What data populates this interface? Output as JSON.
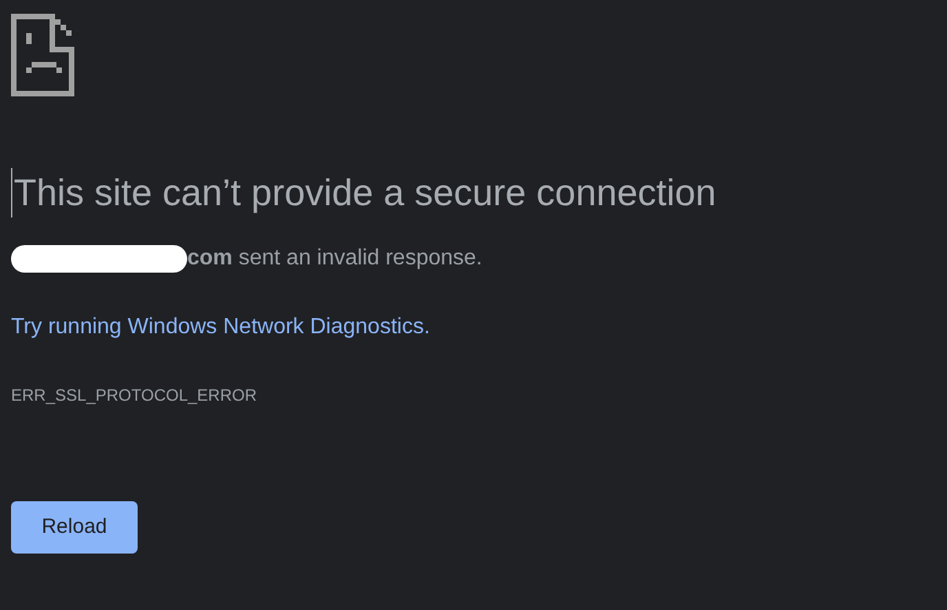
{
  "heading": "This site can’t provide a secure connection",
  "message": "**com** sent an invalid response.",
  "suggestion_link": "Try running Windows Network Diagnostics.",
  "error_code": "ERR_SSL_PROTOCOL_ERROR",
  "buttons": [
    "Reload"
  ]
}
